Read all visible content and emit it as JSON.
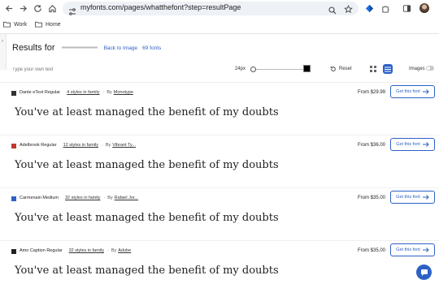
{
  "browser": {
    "url": "myfonts.com/pages/whatthefont?step=resultPage",
    "bookmarks": [
      {
        "label": "Work",
        "icon": "folder-icon"
      },
      {
        "label": "Home",
        "icon": "folder-icon"
      }
    ]
  },
  "header": {
    "title": "Results for",
    "back_link": "Back to Image",
    "count": "69 fonts"
  },
  "toolbar": {
    "type_placeholder": "Type your own text",
    "size": "24px",
    "size_fraction": 0.0,
    "color": "#000000",
    "reset": "Reset",
    "images_label": "Images",
    "images_on": false,
    "active_view": "list"
  },
  "sample_text": "You've at least managed the benefit of my doubts",
  "results": [
    {
      "name": "Dante eText Regular",
      "styles": "4 styles in family",
      "by": "By",
      "foundry": "Monotype",
      "price": "From $29.99",
      "button": "Get this font",
      "logo_color": "#333333"
    },
    {
      "name": "Adelbrook Regular",
      "styles": "12 styles in family",
      "by": "By",
      "foundry": "Vibrant Ty...",
      "price": "From $36.00",
      "button": "Get this font",
      "logo_color": "#c0392b"
    },
    {
      "name": "Carmenain Medium",
      "styles": "32 styles in family",
      "by": "By",
      "foundry": "Rafael Jor...",
      "price": "From $35.00",
      "button": "Get this font",
      "logo_color": "#2e61c6"
    },
    {
      "name": "Amo Caption Regular",
      "styles": "32 styles in family",
      "by": "By",
      "foundry": "Adobe",
      "price": "From $35.00",
      "button": "Get this font",
      "logo_color": "#222222"
    }
  ],
  "colors": {
    "accent": "#2e61c6"
  }
}
